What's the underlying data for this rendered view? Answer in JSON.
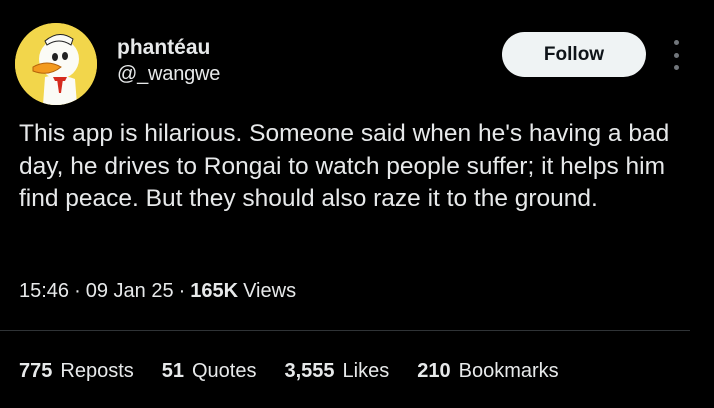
{
  "user": {
    "display_name": "phantéau",
    "handle": "@_wangwe",
    "avatar_icon": "cartoon-duck-avatar"
  },
  "follow_button": {
    "label": "Follow"
  },
  "more_menu": {
    "icon": "more-vertical-icon"
  },
  "tweet": {
    "text": "This app is hilarious. Someone said when he's having a bad day, he drives to Rongai to watch people suffer; it helps him find peace. But they should also raze it to the ground."
  },
  "meta": {
    "time": "15:46",
    "separator": "·",
    "date": "09 Jan 25",
    "views_count": "165K",
    "views_label": "Views"
  },
  "stats": {
    "reposts": {
      "count": "775",
      "label": "Reposts"
    },
    "quotes": {
      "count": "51",
      "label": "Quotes"
    },
    "likes": {
      "count": "3,555",
      "label": "Likes"
    },
    "bookmarks": {
      "count": "210",
      "label": "Bookmarks"
    }
  },
  "colors": {
    "background": "#000000",
    "text": "#e7e9ea",
    "divider": "#2f3336",
    "button_bg": "#eff3f4",
    "button_text": "#0f1419"
  }
}
